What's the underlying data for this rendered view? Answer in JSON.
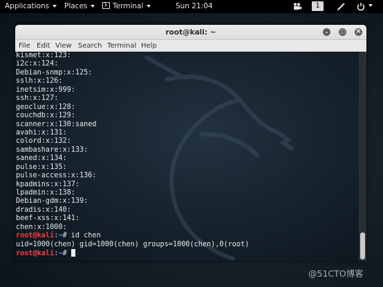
{
  "topbar": {
    "applications": "Applications",
    "places": "Places",
    "terminal": "Terminal",
    "clock": "Sun 21:04",
    "workspace": "1"
  },
  "window": {
    "title": "root@kali: ~",
    "minimize": "–",
    "maximize": "□",
    "close": "×"
  },
  "menu": [
    "File",
    "Edit",
    "View",
    "Search",
    "Terminal",
    "Help"
  ],
  "terminal_lines": [
    {
      "text": "kismet:x:123:"
    },
    {
      "text": "i2c:x:124:"
    },
    {
      "text": "Debian-snmp:x:125:"
    },
    {
      "text": "sslh:x:126:"
    },
    {
      "text": "inetsim:x:999:"
    },
    {
      "text": "ssh:x:127:"
    },
    {
      "text": "geoclue:x:128:"
    },
    {
      "text": "couchdb:x:129:"
    },
    {
      "text": "scanner:x:130:saned"
    },
    {
      "text": "avahi:x:131:"
    },
    {
      "text": "colord:x:132:"
    },
    {
      "text": "sambashare:x:133:"
    },
    {
      "text": "saned:x:134:"
    },
    {
      "text": "pulse:x:135:"
    },
    {
      "text": "pulse-access:x:136:"
    },
    {
      "text": "kpadmins:x:137:"
    },
    {
      "text": "lpadmin:x:138:"
    },
    {
      "text": "Debian-gdm:x:139:"
    },
    {
      "text": "dradis:x:140:"
    },
    {
      "text": "beef-xss:x:141:"
    },
    {
      "text": "chen:x:1000:"
    },
    {
      "prompt": "root@kali",
      "sep": ":",
      "path": "~",
      "sym": "# ",
      "cmd": "id chen"
    },
    {
      "text": "uid=1000(chen) gid=1000(chen) groups=1000(chen),0(root)"
    },
    {
      "prompt": "root@kali",
      "sep": ":",
      "path": "~",
      "sym": "# ",
      "cmd": "",
      "cursor": true
    }
  ],
  "watermark": "@51CTO博客",
  "colors": {
    "prompt": "#ff3b3b",
    "path": "#6f8fff",
    "terminal_text": "#e8e8e8",
    "topbar_bg": "#000000"
  }
}
